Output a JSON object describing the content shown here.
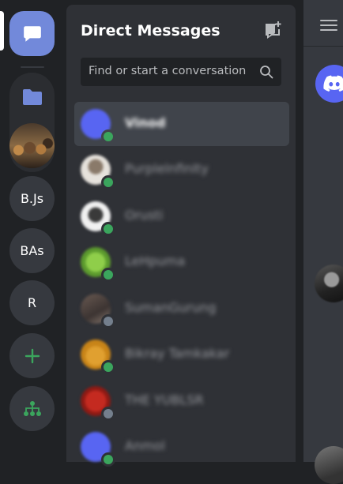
{
  "header": {
    "title": "Direct Messages"
  },
  "search": {
    "placeholder": "Find or start a conversation"
  },
  "servers": [
    {
      "label": "B.Js"
    },
    {
      "label": "BAs"
    },
    {
      "label": "R"
    }
  ],
  "direct_messages": [
    {
      "name": "Vinod",
      "status": "online",
      "selected": true
    },
    {
      "name": "PurplelnfinIty",
      "status": "online"
    },
    {
      "name": "Orusti",
      "status": "online"
    },
    {
      "name": "LeHpuma",
      "status": "online"
    },
    {
      "name": "SumanGurung",
      "status": "offline"
    },
    {
      "name": "Bikray Tamkakar",
      "status": "online"
    },
    {
      "name": "THE YUBLSR",
      "status": "offline"
    },
    {
      "name": "Anmol",
      "status": "online"
    }
  ],
  "colors": {
    "accent": "#7289da",
    "online": "#3ba55d",
    "offline": "#747f8d",
    "add_server": "#3ba55d"
  },
  "icons": {
    "home": "chat-bubble-icon",
    "folder": "folder-icon",
    "add_server": "plus-icon",
    "explore": "hub-icon",
    "new_dm": "new-message-icon",
    "search": "search-icon",
    "menu": "hamburger-icon"
  }
}
